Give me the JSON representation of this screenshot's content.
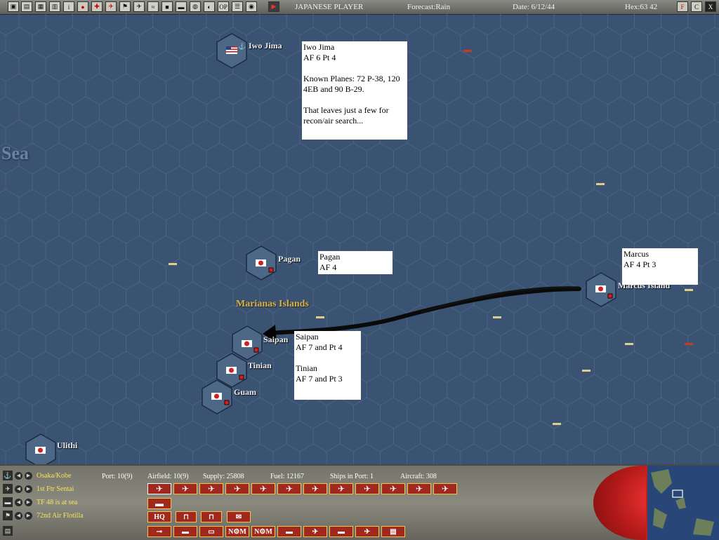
{
  "topbar": {
    "toolbar_icons": [
      "save-icon",
      "document-icon",
      "print-icon",
      "settings-icon",
      "help-icon",
      "record-icon",
      "air-icon",
      "fighter-icon",
      "flag-icon",
      "plane-icon",
      "ground-icon",
      "map-icon",
      "ship-icon",
      "globe-icon",
      "sound-icon",
      "op-label-icon",
      "list-icon",
      "info-icon",
      "end-turn-icon"
    ],
    "op_label": "OP",
    "player": "JAPANESE PLAYER",
    "forecast": "Forecast:Rain",
    "date": "Date: 6/12/44",
    "hex": "Hex:63 42",
    "right_buttons": [
      "F",
      "C",
      "X"
    ]
  },
  "map": {
    "sea_label": "Sea",
    "region_label": "Marianas Islands",
    "bases": [
      {
        "name": "Iwo Jima",
        "flag": "US"
      },
      {
        "name": "Pagan",
        "flag": "JP"
      },
      {
        "name": "Marcus Island",
        "flag": "JP"
      },
      {
        "name": "Saipan",
        "flag": "JP"
      },
      {
        "name": "Tinian",
        "flag": "JP"
      },
      {
        "name": "Guam",
        "flag": "JP"
      },
      {
        "name": "Ulithi",
        "flag": "JP"
      }
    ],
    "notes": {
      "iwo": "Iwo Jima\nAF 6   Pt 4\n\nKnown Planes:  72 P-38, 120 4EB and 90 B-29.\n\nThat leaves just a few for recon/air search...",
      "pagan": "Pagan\nAF 4",
      "marcus": "Marcus\nAF 4  Pt 3",
      "saipan": "Saipan\nAF 7 and Pt 4\n\nTinian\nAF 7 and Pt 3"
    }
  },
  "panel": {
    "rows": [
      {
        "icon": "anchor-icon",
        "label": "Osaka/Kobe"
      },
      {
        "icon": "plane-icon",
        "label": "1st Ftr Sentai"
      },
      {
        "icon": "ship-icon",
        "label": "TF 48 is at sea"
      },
      {
        "icon": "flag-icon",
        "label": "72nd Air Flotilla"
      }
    ],
    "stats": {
      "port": "Port: 10(9)",
      "airfield": "Airfield: 10(9)",
      "supply": "Supply: 25808",
      "fuel": "Fuel: 12167",
      "ships": "Ships in Port: 1",
      "aircraft": "Aircraft: 308"
    },
    "order_buttons": {
      "hq": "HQ",
      "n1": "N",
      "m1": "M",
      "n2": "N",
      "m2": "M"
    }
  },
  "colors": {
    "sea": "#3b5373",
    "accent_red": "#a0281d",
    "label_yellow": "#f6e45a",
    "region_gold": "#d7b24a"
  }
}
